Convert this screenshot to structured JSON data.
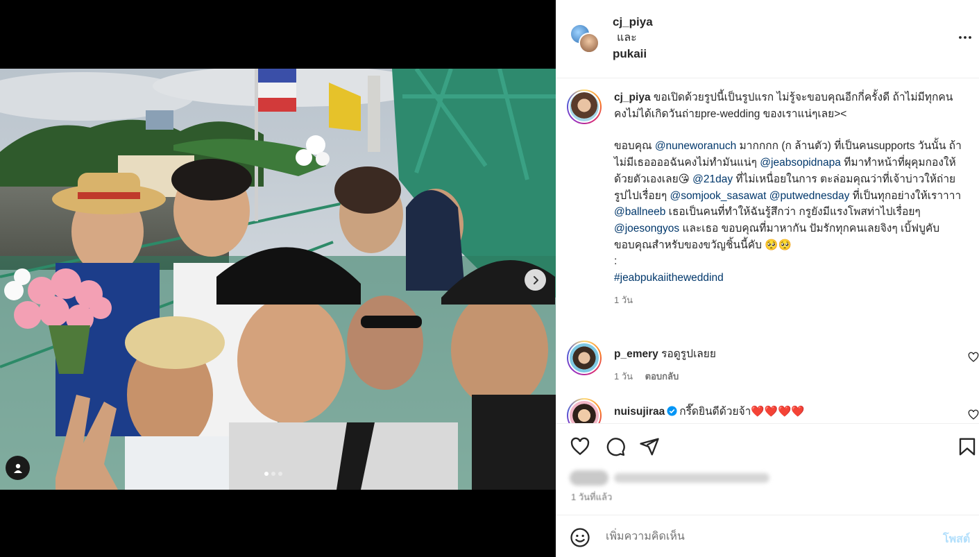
{
  "header": {
    "user1": "cj_piya",
    "and_word": "และ",
    "user2": "pukaii"
  },
  "caption": {
    "username": "cj_piya",
    "line1": "ขอเปิดด้วยรูปนี้เป็นรูปแรก ไม่รู้จะขอบคุณอีกกี่ครั้งดี ถ้าไม่มีทุกคนคงไม่ได้เกิดวันถ่ายpre-wedding ของเราแน่ๆเลย><",
    "p2_a": "ขอบคุณ ",
    "m1": "@nuneworanuch",
    "p2_b": " มากกกก (ก ล้านตัว) ที่เป็นคนsupports วันนั้น ถ้าไม่มีเธออออฉันคงไม่ทำมันแน่ๆ ",
    "m2": "@jeabsopidnapa",
    "p2_c": " ทีมาทำหน้าที่ผุคุมกองให้ด้วยตัวเองเลย😘 ",
    "m3": "@21day",
    "p2_d": " ที่ไม่เหนื่อยในการ ตะล่อมคุณว่าที่เจ้าบ่าวให้ถ่ายรูปไปเรื่อยๆ ",
    "m4": "@somjook_sasawat",
    "p2_e": " ",
    "m5": "@putwednesday",
    "p2_f": " ที่เป็นทุกอย่างให้เราาาา ",
    "m6": "@ballneeb",
    "p2_g": " เธอเป็นคนที่ทำให้ฉันรู้สึกว่า กรูยังมีแรงโพสท่าไปเรื่อยๆ ",
    "m7": "@joesongyos",
    "p2_h": " และเธอ ขอบคุณที่มาหากัน ปัมรักทุกคนเลยจิงๆ เบิ้ฟบูคับ",
    "line3": "ขอบคุณสำหรับของขวัญชิ้นนี้คับ 🥺🥺",
    "line4": ":",
    "hashtag": "#jeabpukaiitheweddind",
    "time": "1 วัน"
  },
  "comments": [
    {
      "username": "p_emery",
      "text": "รอดูรูปเลยย",
      "time": "1 วัน",
      "reply": "ตอบกลับ"
    },
    {
      "username": "nuisujiraa",
      "text": "กรี๊ดยินดีด้วยจ้า❤️❤️❤️❤️"
    }
  ],
  "footer": {
    "time_ago": "1 วันที่แล้ว",
    "comment_placeholder": "เพิ่มความคิดเห็น",
    "post_label": "โพสต์"
  },
  "icons": [
    "more-icon",
    "heart-icon",
    "comment-icon",
    "share-icon",
    "bookmark-icon",
    "emoji-icon",
    "chevron-right-icon",
    "user-tag-icon",
    "verified-icon"
  ],
  "colors": {
    "link": "#00376b",
    "muted": "#737373",
    "post_disabled": "#b2dffc",
    "verified": "#0095f6"
  },
  "carousel": {
    "slides": 3,
    "active": 1
  }
}
